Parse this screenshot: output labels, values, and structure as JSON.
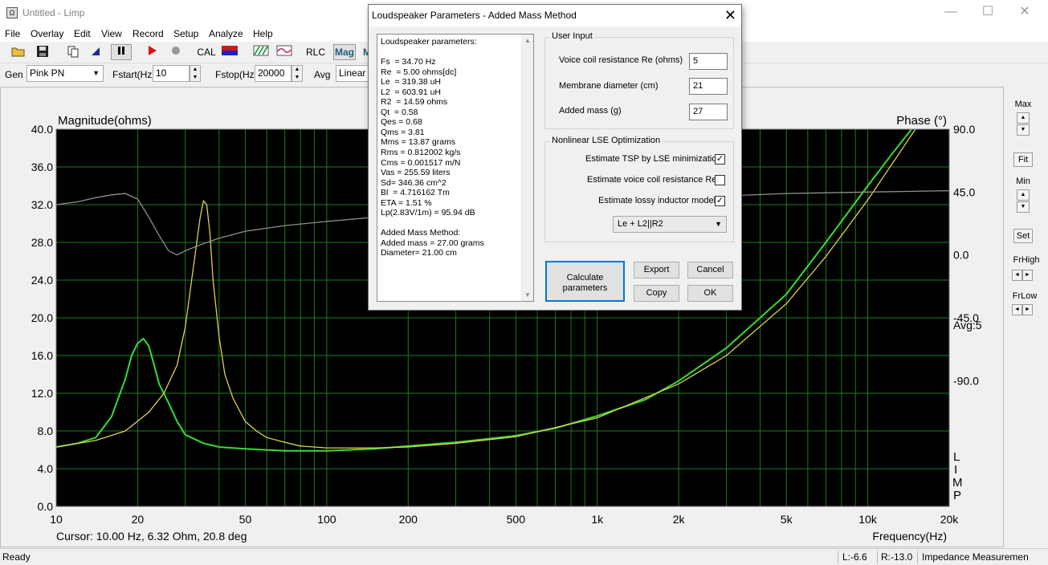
{
  "window": {
    "title": "Untitled - Limp",
    "app_icon": "Ω",
    "minimize": "—",
    "maximize": "☐",
    "close": "✕"
  },
  "menu": [
    "File",
    "Overlay",
    "Edit",
    "View",
    "Record",
    "Setup",
    "Analyze",
    "Help"
  ],
  "toolbar": {
    "cal": "CAL",
    "rlc": "RLC",
    "mag": "Mag",
    "mag2": "M"
  },
  "genbar": {
    "gen_label": "Gen",
    "gen_value": "Pink PN",
    "fstart_label": "Fstart(Hz)",
    "fstart_value": "10",
    "fstop_label": "Fstop(Hz)",
    "fstop_value": "20000",
    "avg_label": "Avg",
    "avg_value": "Linear"
  },
  "chart_data": {
    "type": "line",
    "ylabel": "Magnitude(ohms)",
    "y2label": "Phase (°)",
    "xlabel": "Frequency(Hz)",
    "x_scale": "log",
    "xlim": [
      10,
      20000
    ],
    "ylim": [
      0,
      40
    ],
    "y2lim": [
      -180,
      90
    ],
    "grid": true,
    "y_ticks": [
      "0.0",
      "4.0",
      "8.0",
      "12.0",
      "16.0",
      "20.0",
      "24.0",
      "28.0",
      "32.0",
      "36.0",
      "40.0"
    ],
    "y2_ticks": [
      "90.0",
      "45.0",
      "0.0",
      "-45.0",
      "-90.0"
    ],
    "x_ticks": [
      {
        "value": 10,
        "label": "10"
      },
      {
        "value": 20,
        "label": "20"
      },
      {
        "value": 50,
        "label": "50"
      },
      {
        "value": 100,
        "label": "100"
      },
      {
        "value": 200,
        "label": "200"
      },
      {
        "value": 500,
        "label": "500"
      },
      {
        "value": 1000,
        "label": "1k"
      },
      {
        "value": 2000,
        "label": "2k"
      },
      {
        "value": 5000,
        "label": "5k"
      },
      {
        "value": 10000,
        "label": "10k"
      },
      {
        "value": 20000,
        "label": "20k"
      }
    ],
    "avg_label": "Avg:5",
    "cursor_text": "Cursor: 10.00 Hz, 6.32 Ohm, 20.8 deg",
    "watermark": [
      "L",
      "I",
      "M",
      "P"
    ],
    "colors": {
      "background": "#000000",
      "grid": "#1f7a1f",
      "magnitude": "#33dd33",
      "overlay": "#e0d050",
      "phase": "#909090"
    },
    "series": [
      {
        "axis": "magnitude",
        "color": "#33dd33",
        "x": [
          10,
          12,
          14,
          16,
          18,
          19,
          20,
          21,
          22,
          23,
          24,
          26,
          28,
          30,
          35,
          40,
          50,
          70,
          100,
          150,
          200,
          300,
          500,
          700,
          1000,
          1500,
          2000,
          3000,
          5000,
          7000,
          10000,
          12000,
          14500
        ],
        "y": [
          6.3,
          6.7,
          7.3,
          9.5,
          13.5,
          16.0,
          17.3,
          17.8,
          17.0,
          15.0,
          13.0,
          11.0,
          9.0,
          7.6,
          6.7,
          6.3,
          6.1,
          5.9,
          5.9,
          6.1,
          6.4,
          6.8,
          7.5,
          8.3,
          9.6,
          11.3,
          13.3,
          16.8,
          22.5,
          28.0,
          34.0,
          37.0,
          40.0
        ]
      },
      {
        "axis": "magnitude",
        "color": "#e0d050",
        "x": [
          10,
          14,
          18,
          22,
          25,
          28,
          30,
          32,
          34,
          35,
          36,
          37,
          38,
          40,
          42,
          45,
          50,
          55,
          60,
          70,
          80,
          100,
          150,
          200,
          300,
          500,
          1000,
          2000,
          3000,
          5000,
          7000,
          10000,
          15000
        ],
        "y": [
          6.3,
          7.0,
          8.0,
          10.0,
          12.0,
          15.0,
          19.0,
          25.0,
          30.5,
          32.4,
          32.0,
          29.0,
          24.0,
          18.0,
          14.0,
          11.5,
          9.0,
          8.0,
          7.3,
          6.8,
          6.4,
          6.2,
          6.2,
          6.3,
          6.7,
          7.4,
          9.4,
          13.0,
          16.0,
          21.5,
          26.5,
          32.5,
          40.0
        ]
      },
      {
        "axis": "phase",
        "color": "#909090",
        "x": [
          10,
          12,
          14,
          16,
          18,
          20,
          22,
          24,
          26,
          28,
          30,
          35,
          40,
          50,
          70,
          100,
          150,
          200,
          300,
          500,
          1000,
          2000,
          5000,
          10000,
          20000
        ],
        "y": [
          36,
          38,
          41,
          43,
          44,
          40,
          27,
          14,
          3,
          0,
          3,
          8,
          12,
          17,
          21,
          24,
          27,
          29,
          31,
          34,
          38,
          41,
          44,
          45,
          46
        ]
      }
    ]
  },
  "side": {
    "max_label": "Max",
    "fit_label": "Fit",
    "min_label": "Min",
    "set_label": "Set",
    "frhigh_label": "FrHigh",
    "frlow_label": "FrLow",
    "up": "▲",
    "down": "▼",
    "left": "◄",
    "right": "►"
  },
  "status": {
    "ready": "Ready",
    "l": "L:-6.6",
    "r": "R:-13.0",
    "mode": "Impedance Measuremen"
  },
  "dialog": {
    "title": "Loudspeaker Parameters - Added Mass Method",
    "close": "✕",
    "results": [
      "Loudspeaker parameters:",
      "",
      "Fs  = 34.70 Hz",
      "Re  = 5.00 ohms[dc]",
      "Le  = 319.38 uH",
      "L2  = 603.91 uH",
      "R2  = 14.59 ohms",
      "Qt  = 0.58",
      "Qes = 0.68",
      "Qms = 3.81",
      "Mms = 13.87 grams",
      "Rms = 0.812002 kg/s",
      "Cms = 0.001517 m/N",
      "Vas = 255.59 liters",
      "Sd= 346.36 cm^2",
      "Bl  = 4.716162 Tm",
      "ETA = 1.51 %",
      "Lp(2.83V/1m) = 95.94 dB",
      "",
      "Added Mass Method:",
      "Added mass = 27.00 grams",
      "Diameter= 21.00 cm"
    ],
    "user_input": {
      "title": "User Input",
      "re_label": "Voice coil resistance Re (ohms)",
      "re_value": "5",
      "diameter_label": "Membrane diameter (cm)",
      "diameter_value": "21",
      "mass_label": "Added mass (g)",
      "mass_value": "27"
    },
    "lse": {
      "title": "Nonlinear LSE Optimization",
      "opt1": "Estimate TSP by LSE minimization",
      "opt1_checked": true,
      "opt2": "Estimate voice coil resistance Re",
      "opt2_checked": false,
      "opt3": "Estimate lossy inductor model",
      "opt3_checked": true,
      "model": "Le + L2||R2"
    },
    "buttons": {
      "calculate": "Calculate parameters",
      "export": "Export",
      "cancel": "Cancel",
      "copy": "Copy",
      "ok": "OK"
    }
  }
}
